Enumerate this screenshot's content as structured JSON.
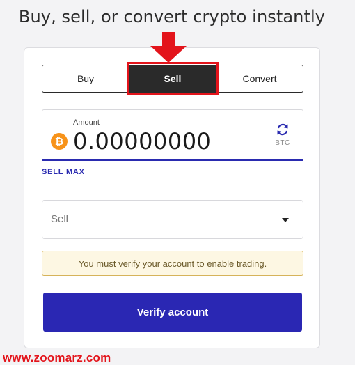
{
  "headline": "Buy, sell, or convert crypto instantly",
  "tabs": {
    "buy": "Buy",
    "sell": "Sell",
    "convert": "Convert",
    "active": "Sell"
  },
  "amount": {
    "label": "Amount",
    "value": "0.00000000",
    "currency_icon": "bitcoin-icon",
    "swap_icon": "swap-icon",
    "currency": "BTC"
  },
  "sell_max": "SELL MAX",
  "asset_select": {
    "placeholder": "Sell"
  },
  "notice": "You must verify your account to enable trading.",
  "verify_button": "Verify account",
  "watermark": "www.zoomarz.com",
  "colors": {
    "primary": "#2a27b3",
    "highlight": "#e3141b",
    "bitcoin": "#f7931a",
    "notice_bg": "#fdf7e3"
  }
}
